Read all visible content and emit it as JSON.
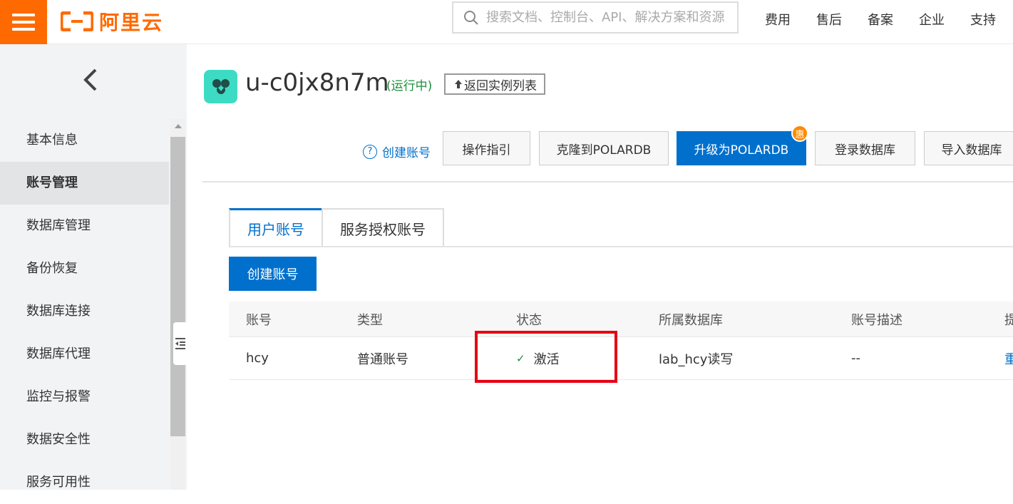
{
  "header": {
    "logo_text": "阿里云",
    "search_placeholder": "搜索文档、控制台、API、解决方案和资源",
    "nav": [
      "费用",
      "售后",
      "备案",
      "企业",
      "支持"
    ]
  },
  "sidebar": {
    "items": [
      {
        "label": "基本信息"
      },
      {
        "label": "账号管理"
      },
      {
        "label": "数据库管理"
      },
      {
        "label": "备份恢复"
      },
      {
        "label": "数据库连接"
      },
      {
        "label": "数据库代理"
      },
      {
        "label": "监控与报警"
      },
      {
        "label": "数据安全性"
      },
      {
        "label": "服务可用性"
      }
    ],
    "active_index": 1
  },
  "instance": {
    "name": "u-c0jx8n7m",
    "status": "(运行中)",
    "back_label": "返回实例列表"
  },
  "toolbar": {
    "help_label": "创建账号",
    "buttons": [
      "操作指引",
      "克隆到POLARDB",
      "升级为POLARDB",
      "登录数据库",
      "导入数据库"
    ],
    "badge": "惠"
  },
  "tabs": [
    "用户账号",
    "服务授权账号"
  ],
  "create_button": "创建账号",
  "table": {
    "headers": [
      "账号",
      "类型",
      "状态",
      "所属数据库",
      "账号描述",
      "提"
    ],
    "rows": [
      {
        "account": "hcy",
        "type": "普通账号",
        "status": "激活",
        "database": "lab_hcy读写",
        "description": "--",
        "op": "重"
      }
    ]
  },
  "colors": {
    "brand": "#ff6a00",
    "primary": "#0070cc",
    "status_ok": "#1e8e3e",
    "highlight": "#e60012"
  }
}
